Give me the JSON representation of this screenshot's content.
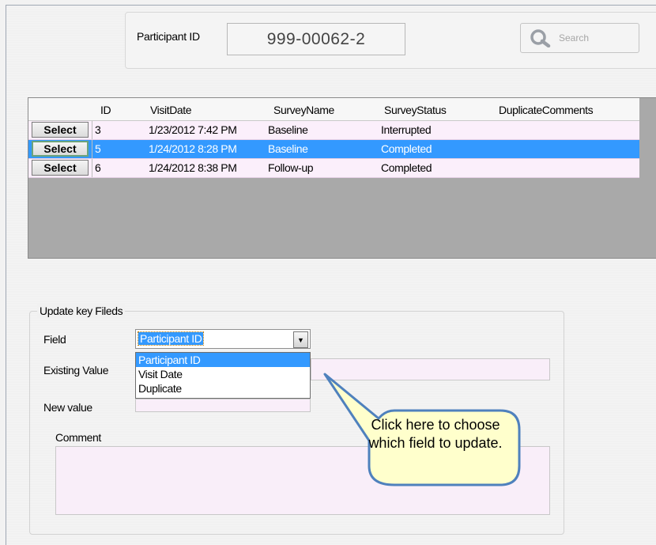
{
  "header": {
    "participant_label": "Participant ID",
    "participant_value": "999-00062-2",
    "search_label": "Search"
  },
  "grid": {
    "columns": [
      "ID",
      "VisitDate",
      "SurveyName",
      "SurveyStatus",
      "DuplicateComments"
    ],
    "rows": [
      {
        "select": "Select",
        "id": "3",
        "visit_date": "1/23/2012 7:42 PM",
        "survey_name": "Baseline",
        "survey_status": "Interrupted",
        "duplicate_comments": ""
      },
      {
        "select": "Select",
        "id": "5",
        "visit_date": "1/24/2012 8:28 PM",
        "survey_name": "Baseline",
        "survey_status": "Completed",
        "duplicate_comments": ""
      },
      {
        "select": "Select",
        "id": "6",
        "visit_date": "1/24/2012 8:38 PM",
        "survey_name": "Follow-up",
        "survey_status": "Completed",
        "duplicate_comments": ""
      }
    ],
    "selected_row_index": 1
  },
  "update": {
    "group_title": "Update key Fileds",
    "field_label": "Field",
    "field_value": "Participant ID",
    "field_options": [
      "Participant ID",
      "Visit Date",
      "Duplicate"
    ],
    "existing_label": "Existing Value",
    "new_label": "New value",
    "comment_label": "Comment"
  },
  "callout": {
    "text": "Click here to choose which field to update."
  },
  "colors": {
    "selection": "#3399ff",
    "row_background": "#fbeffb",
    "callout_fill": "#ffffcc",
    "callout_border": "#4f81bd",
    "grid_background": "#a9a9a9"
  },
  "icons": {
    "search": "magnifier-icon",
    "dropdown": "chevron-down-icon"
  }
}
